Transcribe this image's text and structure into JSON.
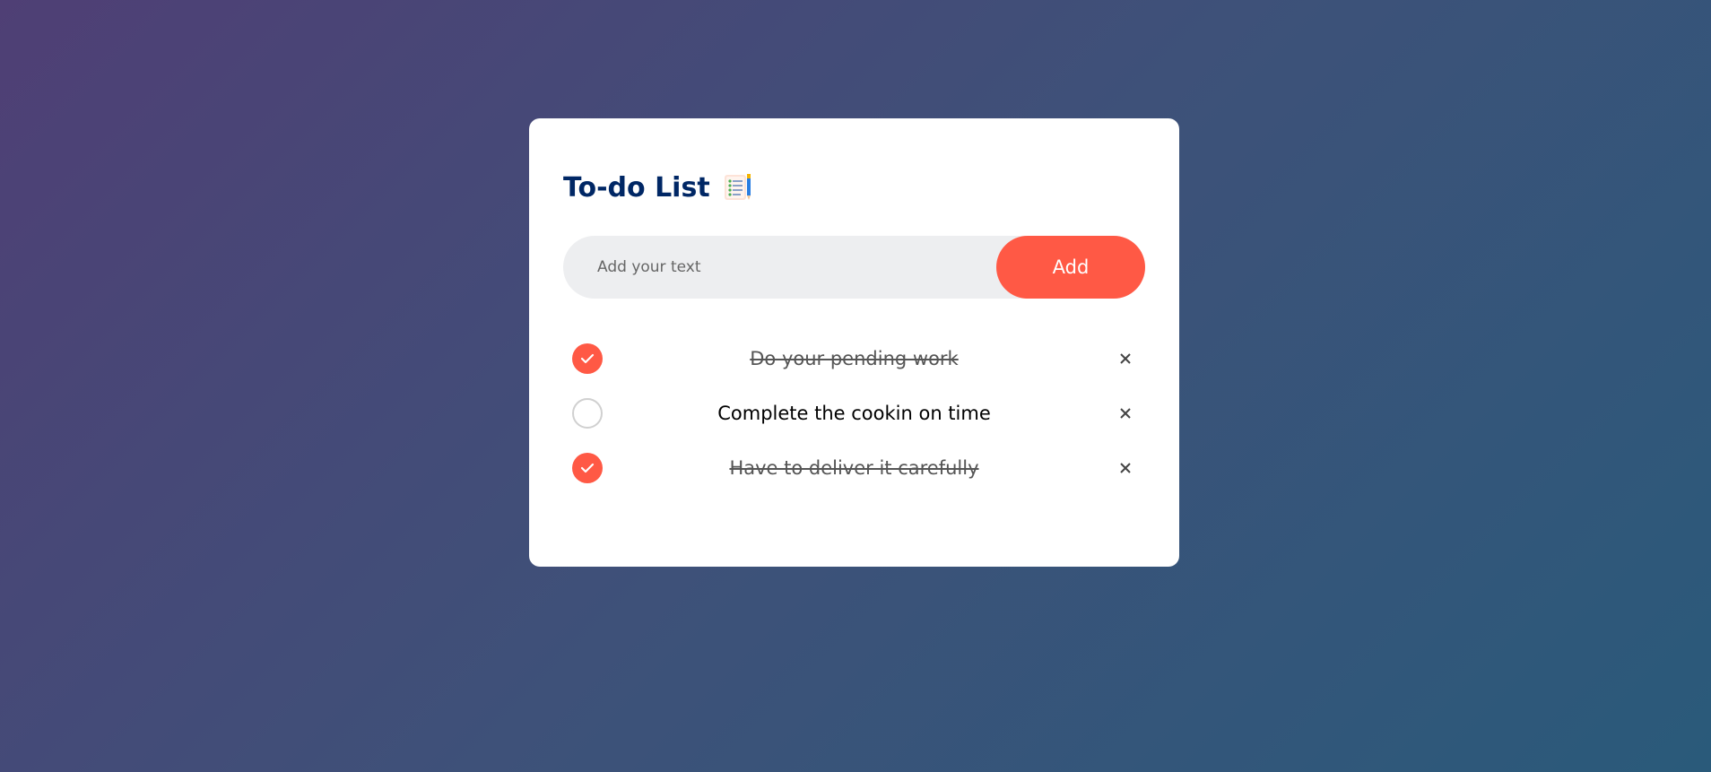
{
  "app": {
    "title": "To-do List",
    "title_icon": "notepad-checklist-icon"
  },
  "input": {
    "placeholder": "Add your text",
    "value": "",
    "add_label": "Add"
  },
  "tasks": [
    {
      "text": "Do your pending work",
      "checked": true
    },
    {
      "text": "Complete the cookin on time",
      "checked": false
    },
    {
      "text": "Have to deliver it carefully",
      "checked": true
    }
  ],
  "colors": {
    "accent": "#ff5945",
    "title": "#002765",
    "input_bg": "#edeef0"
  }
}
